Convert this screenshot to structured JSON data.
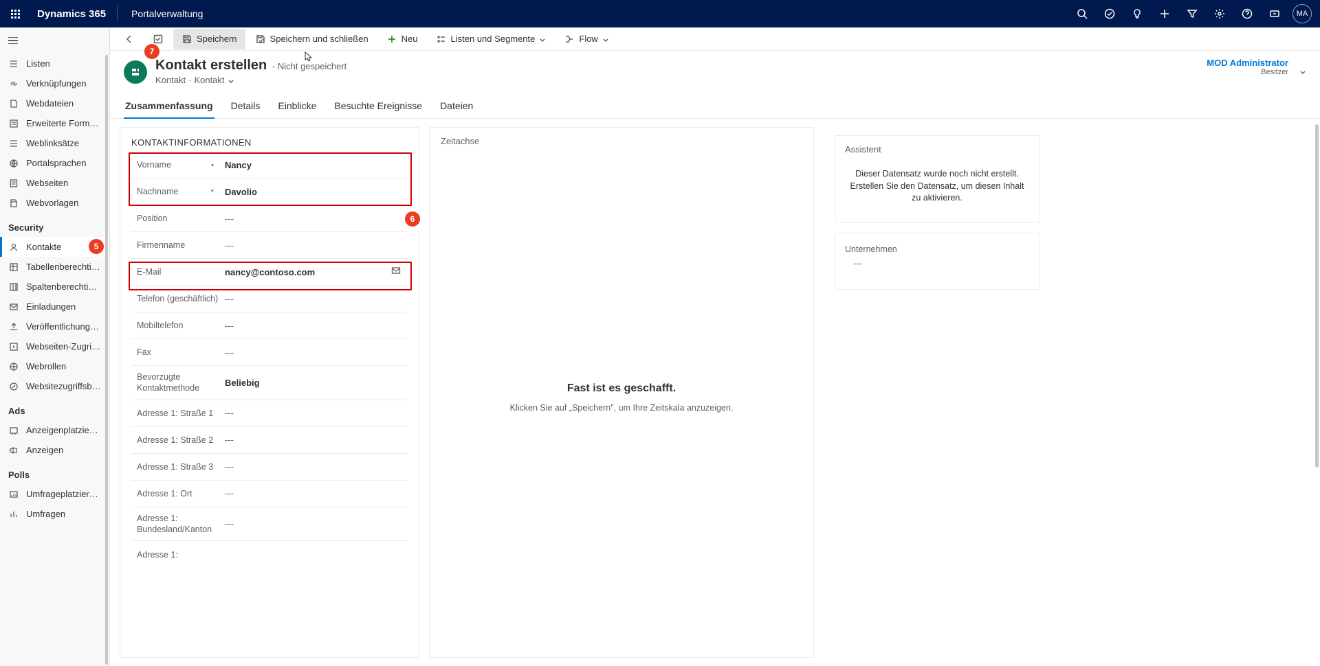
{
  "topbar": {
    "brand": "Dynamics 365",
    "portal": "Portalverwaltung",
    "avatar": "MA"
  },
  "sidebar": {
    "items_top": [
      {
        "label": "Listen",
        "icon": "list"
      },
      {
        "label": "Verknüpfungen",
        "icon": "link"
      },
      {
        "label": "Webdateien",
        "icon": "file"
      },
      {
        "label": "Erweiterte Formul...",
        "icon": "form"
      },
      {
        "label": "Weblinksätze",
        "icon": "list"
      },
      {
        "label": "Portalsprachen",
        "icon": "lang"
      },
      {
        "label": "Webseiten",
        "icon": "page"
      },
      {
        "label": "Webvorlagen",
        "icon": "template"
      }
    ],
    "security_head": "Security",
    "security_items": [
      {
        "label": "Kontakte",
        "icon": "person",
        "selected": true
      },
      {
        "label": "Tabellenberechtig...",
        "icon": "table"
      },
      {
        "label": "Spaltenberechtigu...",
        "icon": "column"
      },
      {
        "label": "Einladungen",
        "icon": "invite"
      },
      {
        "label": "Veröffentlichungs...",
        "icon": "publish"
      },
      {
        "label": "Webseiten-Zugriff...",
        "icon": "access"
      },
      {
        "label": "Webrollen",
        "icon": "globe"
      },
      {
        "label": "Websitezugriffsbe...",
        "icon": "webaccess"
      }
    ],
    "ads_head": "Ads",
    "ads_items": [
      {
        "label": "Anzeigenplatzieru...",
        "icon": "adplace"
      },
      {
        "label": "Anzeigen",
        "icon": "ad"
      }
    ],
    "polls_head": "Polls",
    "polls_items": [
      {
        "label": "Umfrageplatzieru...",
        "icon": "pollplace"
      },
      {
        "label": "Umfragen",
        "icon": "poll"
      }
    ]
  },
  "cmdbar": {
    "save": "Speichern",
    "saveclose": "Speichern und schließen",
    "new": "Neu",
    "listsseg": "Listen und Segmente",
    "flow": "Flow"
  },
  "header": {
    "title": "Kontakt erstellen",
    "status": "- Nicht gespeichert",
    "crumb1": "Kontakt",
    "crumb2": "Kontakt",
    "owner_name": "MOD Administrator",
    "owner_label": "Besitzer"
  },
  "tabs": [
    "Zusammenfassung",
    "Details",
    "Einblicke",
    "Besuchte Ereignisse",
    "Dateien"
  ],
  "contact_section_title": "KONTAKTINFORMATIONEN",
  "fields": [
    {
      "label": "Vorname",
      "value": "Nancy",
      "bold": true,
      "recommend": true
    },
    {
      "label": "Nachname",
      "value": "Davolio",
      "bold": true,
      "required": true
    },
    {
      "label": "Position",
      "value": "---",
      "empty": true
    },
    {
      "label": "Firmenname",
      "value": "---",
      "empty": true
    },
    {
      "label": "E-Mail",
      "value": "nancy@contoso.com",
      "bold": true,
      "mail_icon": true
    },
    {
      "label": "Telefon (geschäftlich)",
      "value": "---",
      "empty": true
    },
    {
      "label": "Mobiltelefon",
      "value": "---",
      "empty": true
    },
    {
      "label": "Fax",
      "value": "---",
      "empty": true
    },
    {
      "label": "Bevorzugte Kontaktmethode",
      "value": "Beliebig",
      "bold": true,
      "multiline": true
    },
    {
      "label": "Adresse 1: Straße 1",
      "value": "---",
      "empty": true
    },
    {
      "label": "Adresse 1: Straße 2",
      "value": "---",
      "empty": true
    },
    {
      "label": "Adresse 1: Straße 3",
      "value": "---",
      "empty": true
    },
    {
      "label": "Adresse 1: Ort",
      "value": "---",
      "empty": true
    },
    {
      "label": "Adresse 1: Bundesland/Kanton",
      "value": "---",
      "empty": true,
      "multiline": true
    },
    {
      "label": "Adresse 1:",
      "value": "",
      "partial": true
    }
  ],
  "timeline": {
    "title": "Zeitachse",
    "heading": "Fast ist es geschafft.",
    "sub": "Klicken Sie auf „Speichern\", um Ihre Zeitskala anzuzeigen."
  },
  "assistant": {
    "title": "Assistent",
    "msg": "Dieser Datensatz wurde noch nicht erstellt. Erstellen Sie den Datensatz, um diesen Inhalt zu aktivieren."
  },
  "company": {
    "label": "Unternehmen",
    "value": "---"
  },
  "badges": {
    "five": "5",
    "six": "6",
    "seven": "7"
  }
}
